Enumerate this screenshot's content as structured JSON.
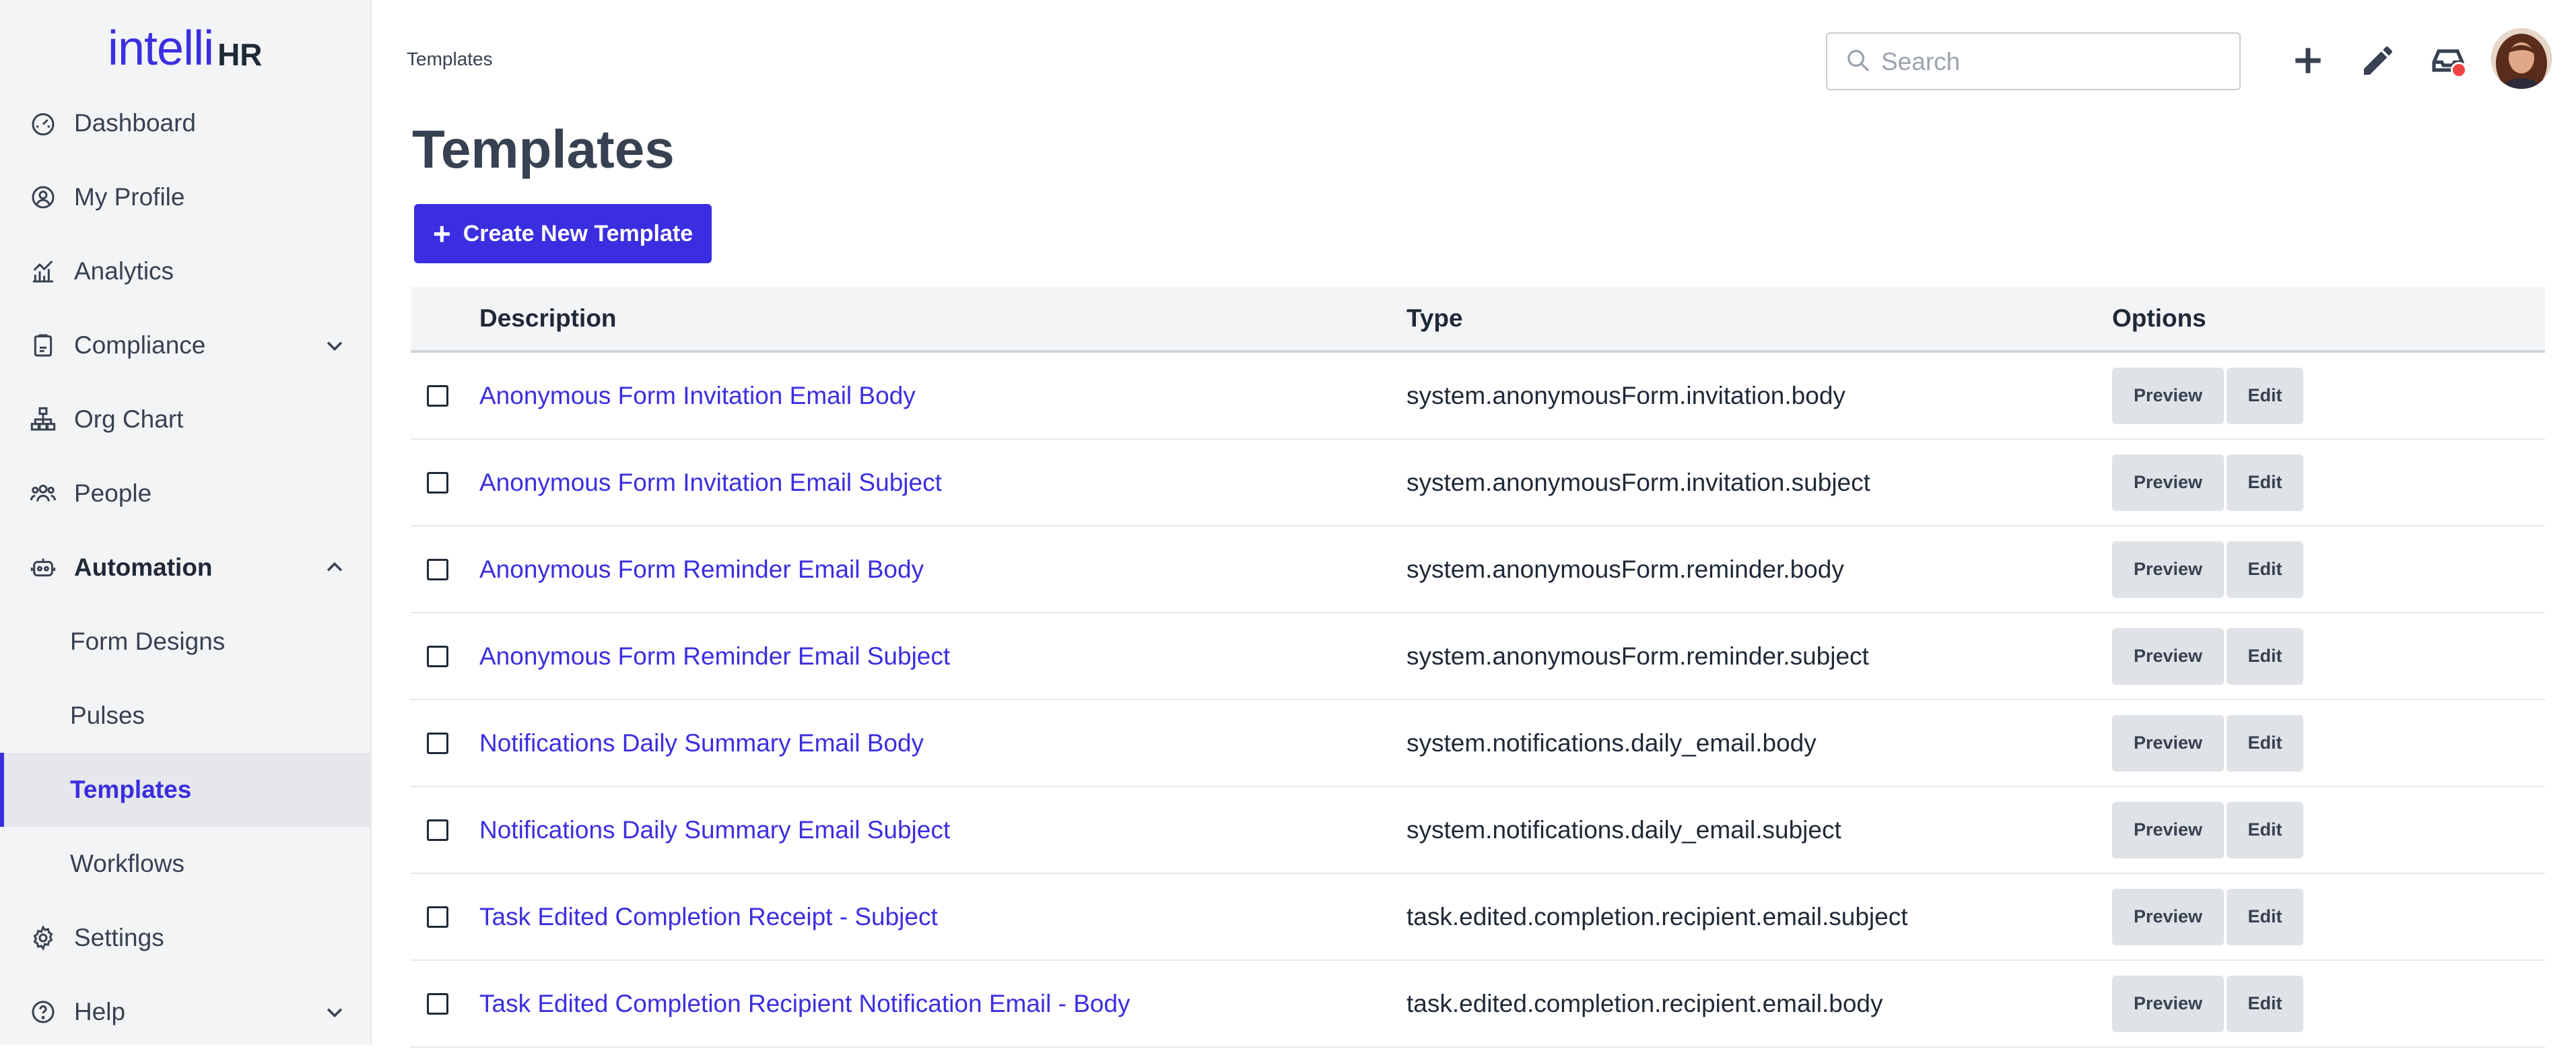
{
  "brand": {
    "logo_text": "intelli",
    "logo_suffix": "HR",
    "accent": "#3b2ee0"
  },
  "sidebar": {
    "items": [
      {
        "label": "Dashboard",
        "icon": "dashboard-icon"
      },
      {
        "label": "My Profile",
        "icon": "user-circle-icon"
      },
      {
        "label": "Analytics",
        "icon": "chart-icon"
      },
      {
        "label": "Compliance",
        "icon": "clipboard-icon",
        "chevron": "down"
      },
      {
        "label": "Org Chart",
        "icon": "org-chart-icon"
      },
      {
        "label": "People",
        "icon": "people-icon"
      },
      {
        "label": "Automation",
        "icon": "robot-icon",
        "chevron": "up",
        "expanded": true
      },
      {
        "label": "Form Designs",
        "sub": true
      },
      {
        "label": "Pulses",
        "sub": true
      },
      {
        "label": "Templates",
        "sub": true,
        "active": true
      },
      {
        "label": "Workflows",
        "sub": true
      },
      {
        "label": "Settings",
        "icon": "gear-icon"
      },
      {
        "label": "Help",
        "icon": "help-icon",
        "chevron": "down"
      }
    ]
  },
  "header": {
    "breadcrumb": "Templates",
    "search_placeholder": "Search"
  },
  "main": {
    "title": "Templates",
    "create_button": "Create New Template",
    "columns": {
      "description": "Description",
      "type": "Type",
      "options": "Options"
    },
    "preview_label": "Preview",
    "edit_label": "Edit",
    "rows": [
      {
        "description": "Anonymous Form Invitation Email Body",
        "type": "system.anonymousForm.invitation.body"
      },
      {
        "description": "Anonymous Form Invitation Email Subject",
        "type": "system.anonymousForm.invitation.subject"
      },
      {
        "description": "Anonymous Form Reminder Email Body",
        "type": "system.anonymousForm.reminder.body"
      },
      {
        "description": "Anonymous Form Reminder Email Subject",
        "type": "system.anonymousForm.reminder.subject"
      },
      {
        "description": "Notifications Daily Summary Email Body",
        "type": "system.notifications.daily_email.body"
      },
      {
        "description": "Notifications Daily Summary Email Subject",
        "type": "system.notifications.daily_email.subject"
      },
      {
        "description": "Task Edited Completion Receipt - Subject",
        "type": "task.edited.completion.recipient.email.subject"
      },
      {
        "description": "Task Edited Completion Recipient Notification Email - Body",
        "type": "task.edited.completion.recipient.email.body"
      }
    ]
  }
}
